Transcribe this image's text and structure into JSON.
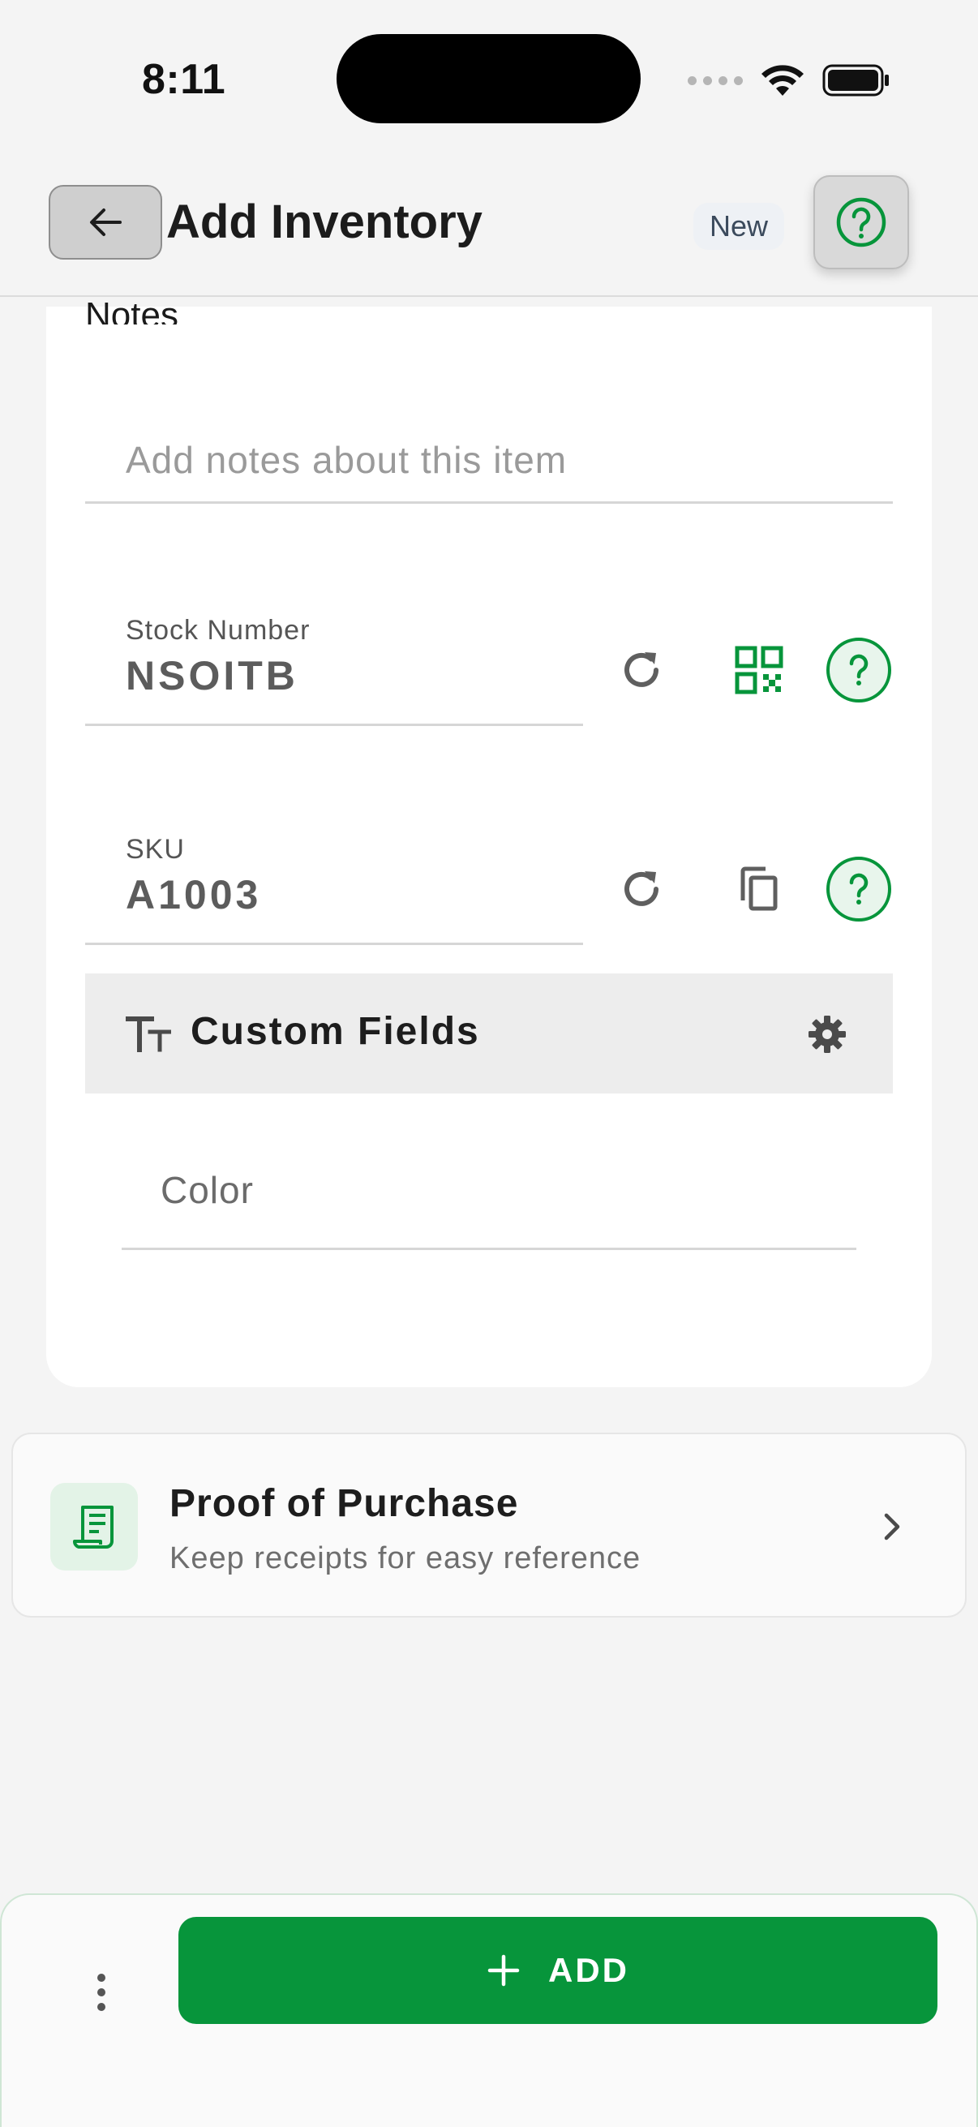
{
  "status_bar": {
    "time": "8:11"
  },
  "header": {
    "title": "Add Inventory",
    "badge": "New",
    "back_icon": "arrow-left-icon",
    "help_icon": "question-circle-icon"
  },
  "form": {
    "notes_label": "Notes",
    "notes_placeholder": "Add notes about this item",
    "stock_number": {
      "label": "Stock Number",
      "value": "NSOITB"
    },
    "sku": {
      "label": "SKU",
      "value": "A1003"
    },
    "custom_fields": {
      "title": "Custom Fields"
    },
    "color_placeholder": "Color"
  },
  "proof_of_purchase": {
    "title": "Proof of Purchase",
    "subtitle": "Keep receipts for easy reference"
  },
  "bottom_bar": {
    "add_label": "ADD"
  },
  "colors": {
    "accent": "#07953b",
    "accent_light": "#e3f3e7",
    "background": "#f4f4f4"
  }
}
